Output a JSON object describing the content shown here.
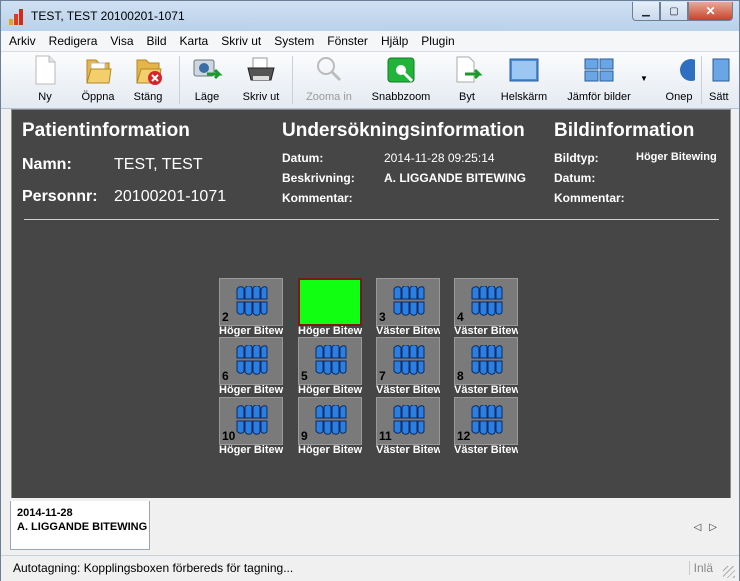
{
  "window": {
    "title": "TEST, TEST 20100201-1071"
  },
  "menu": [
    "Arkiv",
    "Redigera",
    "Visa",
    "Bild",
    "Karta",
    "Skriv ut",
    "System",
    "Fönster",
    "Hjälp",
    "Plugin"
  ],
  "toolbar": {
    "ny": "Ny",
    "oppna": "Öppna",
    "stang": "Stäng",
    "lage": "Läge",
    "skrivut": "Skriv ut",
    "zoomain": "Zooma in",
    "snabbzoom": "Snabbzoom",
    "byt": "Byt",
    "helskarm": "Helskärm",
    "jamfor": "Jämför bilder",
    "onep": "Onep",
    "satt": "Sätt"
  },
  "patient": {
    "heading": "Patientinformation",
    "name_label": "Namn:",
    "name": "TEST, TEST",
    "pnr_label": "Personnr:",
    "pnr": "20100201-1071"
  },
  "exam": {
    "heading": "Undersökningsinformation",
    "date_label": "Datum:",
    "date": "2014-11-28 09:25:14",
    "desc_label": "Beskrivning:",
    "desc": "A. LIGGANDE BITEWING",
    "comment_label": "Kommentar:",
    "comment": ""
  },
  "image": {
    "heading": "Bildinformation",
    "type_label": "Bildtyp:",
    "type": "Höger Bitewing",
    "date_label": "Datum:",
    "date": "",
    "comment_label": "Kommentar:",
    "comment": ""
  },
  "thumbs": [
    {
      "num": "2",
      "caption": "Höger Bitewing",
      "selected": false
    },
    {
      "num": "",
      "caption": "Höger Bitewing",
      "selected": true
    },
    {
      "num": "3",
      "caption": "Väster Bitewing",
      "selected": false
    },
    {
      "num": "4",
      "caption": "Väster Bitewing",
      "selected": false
    },
    {
      "num": "6",
      "caption": "Höger Bitewing",
      "selected": false
    },
    {
      "num": "5",
      "caption": "Höger Bitewing",
      "selected": false
    },
    {
      "num": "7",
      "caption": "Väster Bitewing",
      "selected": false
    },
    {
      "num": "8",
      "caption": "Väster Bitewing",
      "selected": false
    },
    {
      "num": "10",
      "caption": "Höger Bitewing",
      "selected": false
    },
    {
      "num": "9",
      "caption": "Höger Bitewing",
      "selected": false
    },
    {
      "num": "11",
      "caption": "Väster Bitewing",
      "selected": false
    },
    {
      "num": "12",
      "caption": "Väster Bitewing",
      "selected": false
    }
  ],
  "tab": {
    "date": "2014-11-28",
    "title": "A. LIGGANDE BITEWING"
  },
  "status": {
    "message": "Autotagning: Kopplingsboxen förbereds för tagning...",
    "mode": "Inlä"
  },
  "colors": {
    "panel": "#464646",
    "selected_thumb": "#11ff11"
  }
}
